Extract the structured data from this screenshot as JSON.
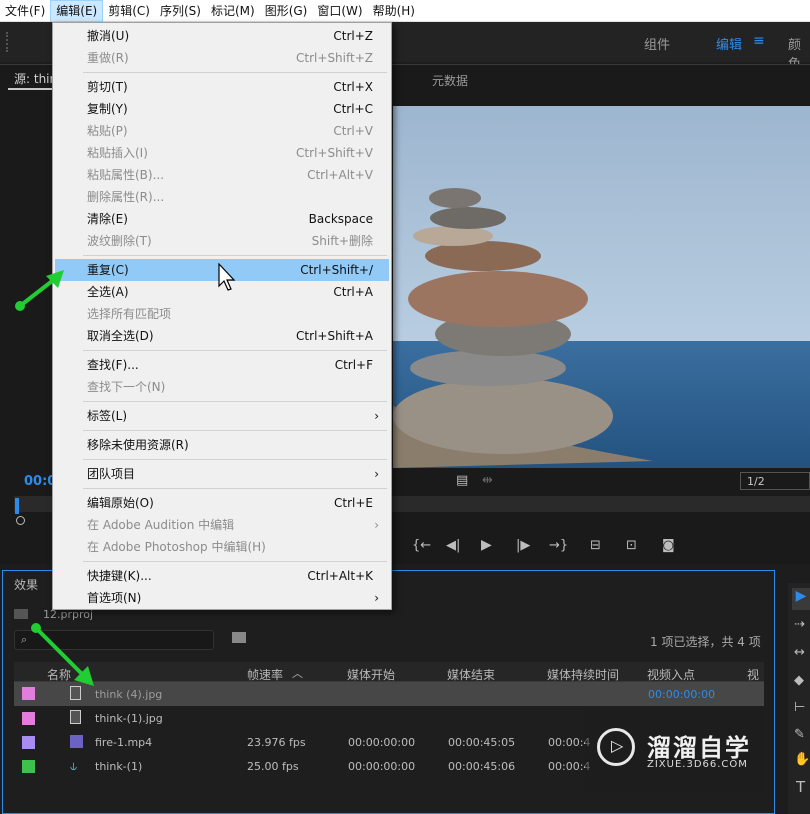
{
  "menubar": {
    "items": [
      "文件(F)",
      "编辑(E)",
      "剪辑(C)",
      "序列(S)",
      "标记(M)",
      "图形(G)",
      "窗口(W)",
      "帮助(H)"
    ]
  },
  "workspace": {
    "tabs": [
      "组件",
      "编辑",
      "颜色"
    ]
  },
  "source": {
    "tab_label": "源: thin",
    "metadata_label": "元数据",
    "timecode": "00:0",
    "resolution": "1/2"
  },
  "edit_menu": {
    "items": [
      {
        "label": "撤消(U)",
        "shortcut": "Ctrl+Z",
        "enabled": true
      },
      {
        "label": "重做(R)",
        "shortcut": "Ctrl+Shift+Z",
        "enabled": false
      },
      {
        "label": "剪切(T)",
        "shortcut": "Ctrl+X",
        "enabled": true
      },
      {
        "label": "复制(Y)",
        "shortcut": "Ctrl+C",
        "enabled": true
      },
      {
        "label": "粘贴(P)",
        "shortcut": "Ctrl+V",
        "enabled": false
      },
      {
        "label": "粘贴插入(I)",
        "shortcut": "Ctrl+Shift+V",
        "enabled": false
      },
      {
        "label": "粘贴属性(B)...",
        "shortcut": "Ctrl+Alt+V",
        "enabled": false
      },
      {
        "label": "删除属性(R)...",
        "shortcut": "",
        "enabled": false
      },
      {
        "label": "清除(E)",
        "shortcut": "Backspace",
        "enabled": true
      },
      {
        "label": "波纹删除(T)",
        "shortcut": "Shift+删除",
        "enabled": false
      },
      {
        "label": "重复(C)",
        "shortcut": "Ctrl+Shift+/",
        "enabled": true,
        "highlighted": true
      },
      {
        "label": "全选(A)",
        "shortcut": "Ctrl+A",
        "enabled": true
      },
      {
        "label": "选择所有匹配项",
        "shortcut": "",
        "enabled": false
      },
      {
        "label": "取消全选(D)",
        "shortcut": "Ctrl+Shift+A",
        "enabled": true
      },
      {
        "label": "查找(F)...",
        "shortcut": "Ctrl+F",
        "enabled": true
      },
      {
        "label": "查找下一个(N)",
        "shortcut": "",
        "enabled": false
      },
      {
        "label": "标签(L)",
        "shortcut": "",
        "enabled": true,
        "submenu": true
      },
      {
        "label": "移除未使用资源(R)",
        "shortcut": "",
        "enabled": true
      },
      {
        "label": "团队项目",
        "shortcut": "",
        "enabled": true,
        "submenu": true
      },
      {
        "label": "编辑原始(O)",
        "shortcut": "Ctrl+E",
        "enabled": true
      },
      {
        "label": "在 Adobe Audition 中编辑",
        "shortcut": "",
        "enabled": false,
        "submenu": true
      },
      {
        "label": "在 Adobe Photoshop 中编辑(H)",
        "shortcut": "",
        "enabled": false
      },
      {
        "label": "快捷键(K)...",
        "shortcut": "Ctrl+Alt+K",
        "enabled": true
      },
      {
        "label": "首选项(N)",
        "shortcut": "",
        "enabled": true,
        "submenu": true
      }
    ]
  },
  "project": {
    "panel_tab": "效果",
    "project_name": "12.prproj",
    "selection_status": "1 项已选择，共 4 项",
    "columns": [
      "名称",
      "帧速率",
      "媒体开始",
      "媒体结束",
      "媒体持续时间",
      "视频入点",
      "视"
    ],
    "rows": [
      {
        "name": "think (4).jpg",
        "fps": "",
        "start": "",
        "end": "",
        "duration": "",
        "in": "00:00:00:00",
        "color": "#e37ddb",
        "selected": true
      },
      {
        "name": "think-(1).jpg",
        "fps": "",
        "start": "",
        "end": "",
        "duration": "",
        "in": "",
        "color": "#e37ddb",
        "selected": false
      },
      {
        "name": "fire-1.mp4",
        "fps": "23.976 fps",
        "start": "00:00:00:00",
        "end": "00:00:45:05",
        "duration": "00:00:4",
        "in": "",
        "color": "#a88df0",
        "selected": false
      },
      {
        "name": "think-(1)",
        "fps": "25.00 fps",
        "start": "00:00:00:00",
        "end": "00:00:45:06",
        "duration": "00:00:4",
        "in": "",
        "color": "#3fbf4e",
        "selected": false
      }
    ]
  },
  "watermark": {
    "brand": "溜溜自学",
    "url": "ZIXUE.3D66.COM"
  },
  "colors": {
    "accent": "#2d8ceb",
    "menu_highlight": "#91c9f7",
    "annotation_arrow": "#22cc33"
  }
}
